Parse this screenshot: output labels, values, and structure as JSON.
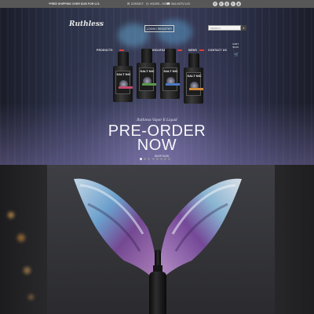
{
  "topbar": {
    "promo": "*FREE SHIPPING OVER $100 FOR U.S.",
    "contact": "CONTACT",
    "hours": "HOURS - NOW",
    "phone": "844-NOTV-LOV",
    "social": [
      "f",
      "t",
      "y",
      "i",
      "g"
    ]
  },
  "header": {
    "logo_text": "Ruthless",
    "login_label": "LOGIN / REGISTER",
    "search_placeholder": "SEARCH",
    "cart_label": "CART",
    "cart_value": "$0.00"
  },
  "nav": {
    "items": [
      "PRODUCTS",
      "WHOLESALE",
      "NEWS",
      "CONTACT US"
    ]
  },
  "hero": {
    "bottle_label": "SALT NIC",
    "tagline": "Ruthless Vapor E-Liquid",
    "headline_line1": "PRE-ORDER",
    "headline_line2": "NOW",
    "button_label": "SHOP NOW",
    "slide_count": 8,
    "active_slide": 1
  },
  "colors": {
    "topbar_bg": "#575757",
    "badge_red": "#e23a3a",
    "headline": "#f6f6fa"
  }
}
